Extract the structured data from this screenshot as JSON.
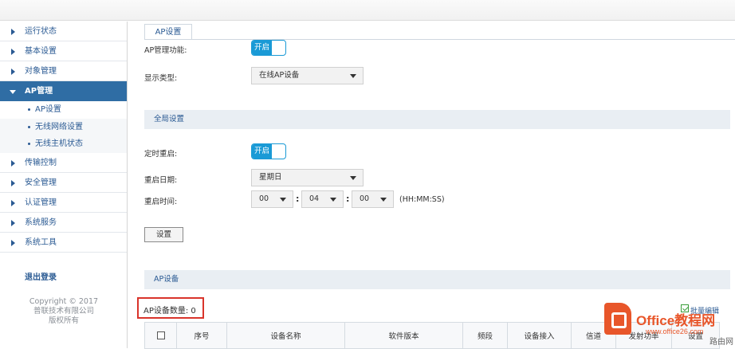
{
  "sidebar": {
    "items": [
      {
        "label": "运行状态"
      },
      {
        "label": "基本设置"
      },
      {
        "label": "对象管理"
      },
      {
        "label": "AP管理"
      },
      {
        "label": "传输控制"
      },
      {
        "label": "安全管理"
      },
      {
        "label": "认证管理"
      },
      {
        "label": "系统服务"
      },
      {
        "label": "系统工具"
      }
    ],
    "sub_items": [
      {
        "label": "AP设置"
      },
      {
        "label": "无线网络设置"
      },
      {
        "label": "无线主机状态"
      }
    ],
    "logout": "退出登录",
    "copyright_line1": "Copyright © 2017",
    "copyright_line2": "普联技术有限公司",
    "copyright_line3": "版权所有"
  },
  "tab": {
    "label": "AP设置"
  },
  "ap_management": {
    "label": "AP管理功能:",
    "toggle_label": "开启",
    "display_type_label": "显示类型:",
    "display_type_value": "在线AP设备"
  },
  "global_settings": {
    "title": "全局设置",
    "scheduled_reboot_label": "定时重启:",
    "scheduled_reboot_toggle": "开启",
    "reboot_date_label": "重启日期:",
    "reboot_date_value": "星期日",
    "reboot_time_label": "重启时间:",
    "hour": "00",
    "minute": "04",
    "second": "00",
    "separator": ":",
    "time_format": "(HH:MM:SS)",
    "apply_button": "设置"
  },
  "ap_devices": {
    "title": "AP设备",
    "count_label": "AP设备数量: 0",
    "batch_edit": "批量编辑",
    "columns": [
      "序号",
      "设备名称",
      "软件版本",
      "频段",
      "设备接入",
      "信道",
      "发射功率",
      "设置"
    ]
  },
  "watermark": {
    "brand": "Office教程网",
    "url": "www.office26.com",
    "corner": "路由网"
  },
  "colors": {
    "accent": "#1a9ad6",
    "nav_active": "#2f6da4",
    "highlight_box": "#d9342b"
  }
}
